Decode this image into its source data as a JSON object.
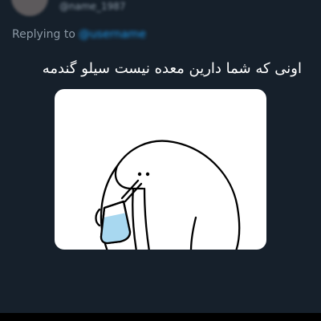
{
  "header": {
    "handle": "@name_1987"
  },
  "reply": {
    "label": "Replying to",
    "mention": "@username"
  },
  "tweet": {
    "text": "اونی که شما دارین معده نیست سیلو گندمه"
  },
  "media": {
    "alt": "cartoon-character-drinking-from-cup"
  },
  "colors": {
    "background": "#16202b",
    "text": "#ffffff",
    "muted": "#8b98a5",
    "accent": "#1d9bf0",
    "cup": "#a8d8f0"
  }
}
